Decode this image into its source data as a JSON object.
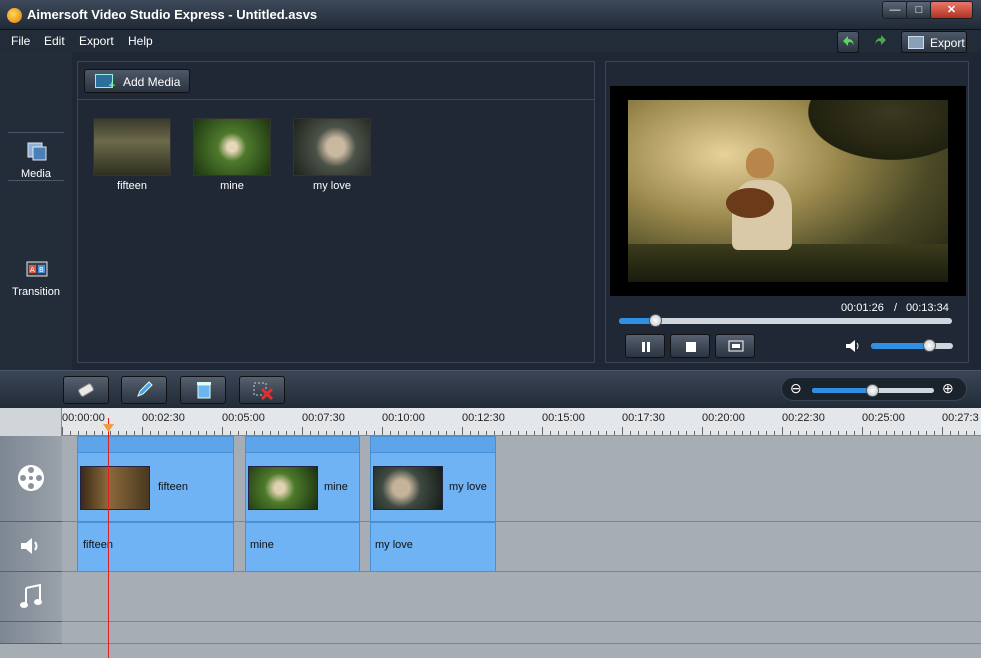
{
  "window": {
    "title": "Aimersoft Video Studio Express - Untitled.asvs",
    "min": "—",
    "max": "□",
    "close": "✕"
  },
  "menu": [
    "File",
    "Edit",
    "Export",
    "Help"
  ],
  "toolbar": {
    "export_label": "Export"
  },
  "sidenav": {
    "media_label": "Media",
    "transition_label": "Transition"
  },
  "media": {
    "add_label": "Add Media",
    "items": [
      {
        "label": "fifteen"
      },
      {
        "label": "mine"
      },
      {
        "label": "my love"
      }
    ]
  },
  "preview": {
    "current_time": "00:01:26",
    "separator": "/",
    "total_time": "00:13:34",
    "seek_fraction": 0.11,
    "volume_fraction": 0.72
  },
  "timeline": {
    "zoom_fraction": 0.5,
    "ruler": [
      "00:00:00",
      "00:02:30",
      "00:05:00",
      "00:07:30",
      "00:10:00",
      "00:12:30",
      "00:15:00",
      "00:17:30",
      "00:20:00",
      "00:22:30",
      "00:25:00",
      "00:27:3"
    ],
    "video_clips": [
      "fifteen",
      "mine",
      "my love"
    ],
    "audio_clips": [
      "fifteen",
      "mine",
      "my love"
    ]
  },
  "colors": {
    "accent": "#2f8fe3",
    "clip": "#6fb3f5",
    "playhead": "#e02020"
  }
}
